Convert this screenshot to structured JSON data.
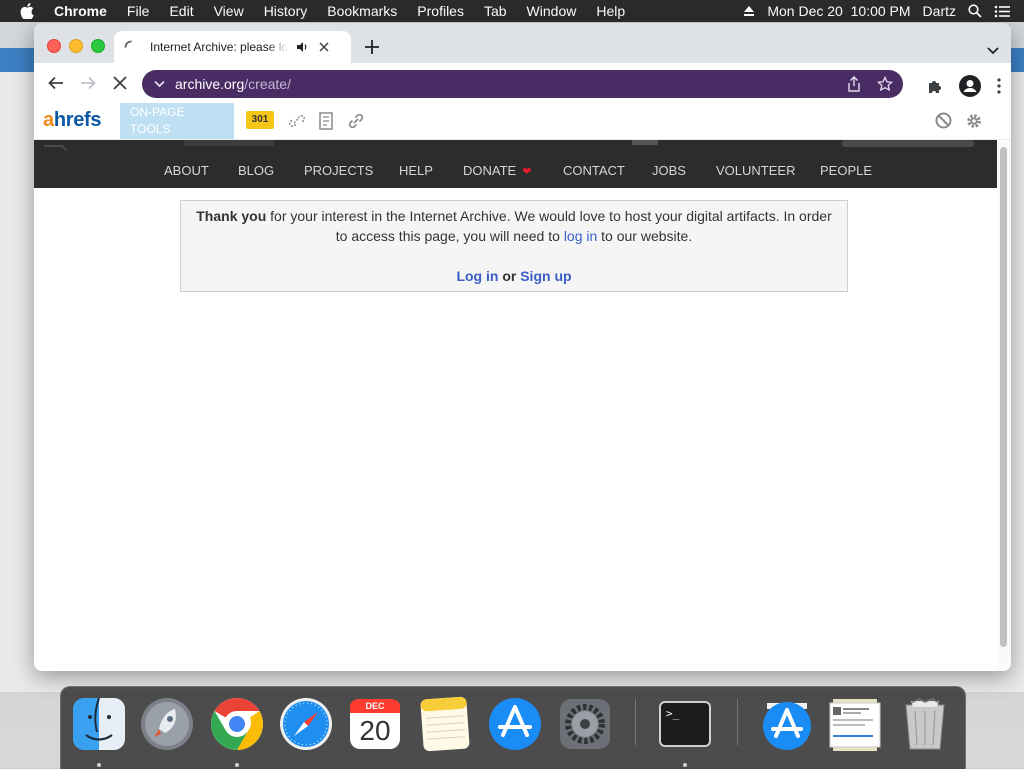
{
  "menubar": {
    "app": "Chrome",
    "items": [
      "File",
      "Edit",
      "View",
      "History",
      "Bookmarks",
      "Profiles",
      "Tab",
      "Window",
      "Help"
    ],
    "datetime": "Mon Dec 20  10:00 PM",
    "user": "Dartz"
  },
  "tab": {
    "title": "Internet Archive: please log in"
  },
  "address": {
    "host": "archive.org",
    "path": "/create/"
  },
  "ahrefs": {
    "logo_a": "a",
    "logo_rest": "hrefs",
    "onpage_line1": "ON-PAGE",
    "onpage_line2": "TOOLS",
    "status_code": "301"
  },
  "site_nav": [
    "ABOUT",
    "BLOG",
    "PROJECTS",
    "HELP",
    "DONATE",
    "CONTACT",
    "JOBS",
    "VOLUNTEER",
    "PEOPLE"
  ],
  "notice": {
    "bold_intro": "Thank you",
    "line1_rest": " for your interest in the Internet Archive. We would love to host your digital artifacts. In order",
    "line2_pre": "to access this page, you will need to ",
    "line2_link": "log in",
    "line2_post": " to our website.",
    "login": "Log in",
    "or": " or ",
    "signup": "Sign up"
  },
  "dock": {
    "calendar_month": "DEC",
    "calendar_day": "20",
    "terminal_prompt": ">_"
  },
  "colors": {
    "omnibox": "#4a2c65",
    "nav_bg": "#2c2c2c",
    "link": "#3a5ec5",
    "ahrefs_orange": "#f08a1d",
    "ahrefs_blue": "#0a58a5"
  }
}
